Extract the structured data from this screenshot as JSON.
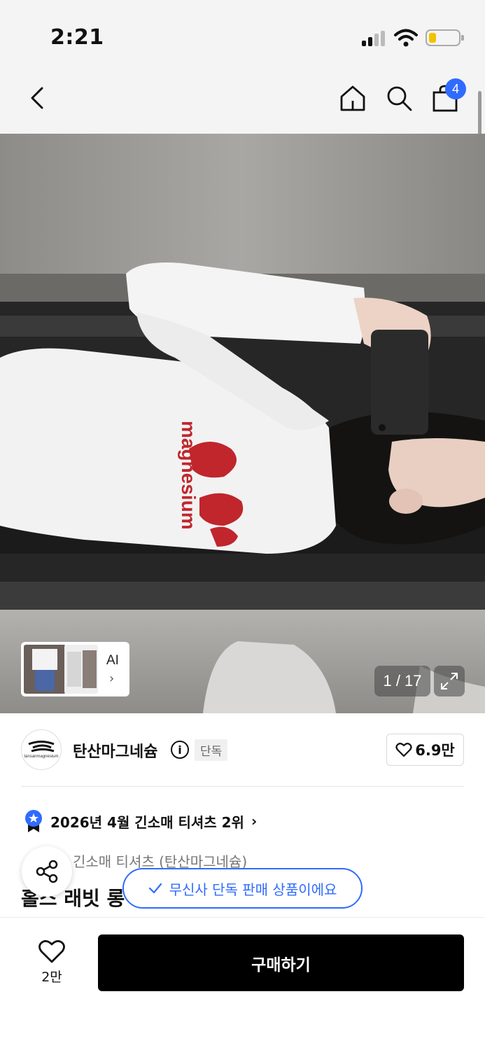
{
  "status_bar": {
    "time": "2:21"
  },
  "nav": {
    "cart_count": "4"
  },
  "gallery": {
    "thumb_label": "AI",
    "counter": "1 / 17",
    "print_text": "magnesium"
  },
  "brand": {
    "name": "탄산마그네슘",
    "logo_text": "tansanmagnesium",
    "tag": "단독",
    "likes": "6.9만"
  },
  "product": {
    "rank": "2026년 4월 긴소매 티셔츠 2위",
    "category": "긴소매 티셔츠 (탄산마그네슘)",
    "title_partial": "홀스 래빗 롱"
  },
  "exclusive_banner": "무신사 단독 판매 상품이에요",
  "bottom": {
    "like_count": "2만",
    "buy_label": "구매하기"
  },
  "colors": {
    "accent_blue": "#2f6bff",
    "buy_black": "#000000",
    "print_red": "#c0262c"
  }
}
